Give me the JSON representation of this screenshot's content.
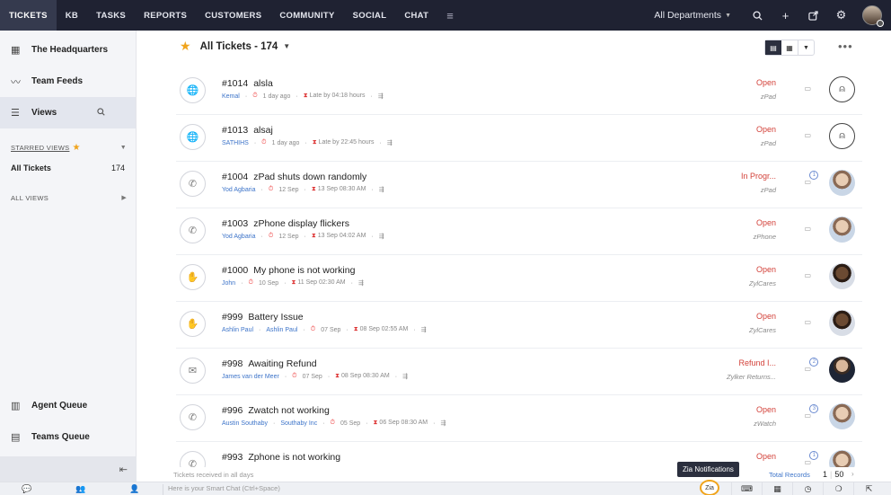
{
  "topnav": {
    "items": [
      "TICKETS",
      "KB",
      "TASKS",
      "REPORTS",
      "CUSTOMERS",
      "COMMUNITY",
      "SOCIAL",
      "CHAT"
    ],
    "department": "All Departments"
  },
  "sidebar": {
    "items": [
      {
        "label": "The Headquarters",
        "icon": "grid-icon"
      },
      {
        "label": "Team Feeds",
        "icon": "feeds-icon"
      },
      {
        "label": "Views",
        "icon": "views-icon"
      }
    ],
    "starred_label": "STARRED VIEWS",
    "starred": [
      {
        "label": "All Tickets",
        "count": "174"
      }
    ],
    "all_views_label": "ALL VIEWS",
    "bottom_items": [
      {
        "label": "Agent Queue",
        "icon": "agent-queue-icon"
      },
      {
        "label": "Teams Queue",
        "icon": "teams-queue-icon"
      }
    ]
  },
  "main": {
    "title": "All Tickets - 174",
    "tickets": [
      {
        "num": "#1014",
        "subject": "alsla",
        "contact": "Kemal",
        "account": "",
        "age": "1 day ago",
        "due": "Late by 04:18 hours",
        "status": "Open",
        "dept": "zPad",
        "channel": "web",
        "assignee": "none",
        "comments": ""
      },
      {
        "num": "#1013",
        "subject": "alsaj",
        "contact": "SATHIHS",
        "account": "",
        "age": "1 day ago",
        "due": "Late by 22:45 hours",
        "status": "Open",
        "dept": "zPad",
        "channel": "web",
        "assignee": "none",
        "comments": ""
      },
      {
        "num": "#1004",
        "subject": "zPad shuts down randomly",
        "contact": "Yod Agbaria",
        "account": "",
        "age": "12 Sep",
        "due": "13 Sep 08:30 AM",
        "status": "In Progr...",
        "dept": "zPad",
        "channel": "phone",
        "assignee": "photo",
        "comments": "1"
      },
      {
        "num": "#1003",
        "subject": "zPhone display flickers",
        "contact": "Yod Agbaria",
        "account": "",
        "age": "12 Sep",
        "due": "13 Sep 04:02 AM",
        "status": "Open",
        "dept": "zPhone",
        "channel": "phone",
        "assignee": "photo",
        "comments": ""
      },
      {
        "num": "#1000",
        "subject": "My phone is not working",
        "contact": "John",
        "account": "",
        "age": "10 Sep",
        "due": "11 Sep 02:30 AM",
        "status": "Open",
        "dept": "ZylCares",
        "channel": "feedback",
        "assignee": "photo-dark",
        "comments": ""
      },
      {
        "num": "#999",
        "subject": "Battery Issue",
        "contact": "Ashlin Paul",
        "account": "Ashlin Paul",
        "age": "07 Sep",
        "due": "08 Sep 02:55 AM",
        "status": "Open",
        "dept": "ZylCares",
        "channel": "feedback-red",
        "assignee": "photo-dark",
        "comments": ""
      },
      {
        "num": "#998",
        "subject": "Awaiting Refund",
        "contact": "James van der Meer",
        "account": "",
        "age": "07 Sep",
        "due": "08 Sep 08:30 AM",
        "status": "Refund I...",
        "dept": "Zylker Returns...",
        "channel": "email",
        "assignee": "photo-suit",
        "comments": "2"
      },
      {
        "num": "#996",
        "subject": "Zwatch not working",
        "contact": "Austin Southaby",
        "account": "Southaby Inc",
        "age": "05 Sep",
        "due": "06 Sep 08:30 AM",
        "status": "Open",
        "dept": "zWatch",
        "channel": "phone",
        "assignee": "photo",
        "comments": "3"
      },
      {
        "num": "#993",
        "subject": "Zphone is not working",
        "contact": "",
        "account": "",
        "age": "",
        "due": "",
        "status": "Open",
        "dept": "",
        "channel": "phone",
        "assignee": "photo",
        "comments": "1"
      }
    ]
  },
  "footer": {
    "received": "Tickets received in all days",
    "total_label": "Total Records",
    "page": "1",
    "per_page": "50"
  },
  "tooltip": "Zia Notifications",
  "bottombar": {
    "chat_placeholder": "Here is your Smart Chat (Ctrl+Space)",
    "zia_label": "Zia"
  }
}
